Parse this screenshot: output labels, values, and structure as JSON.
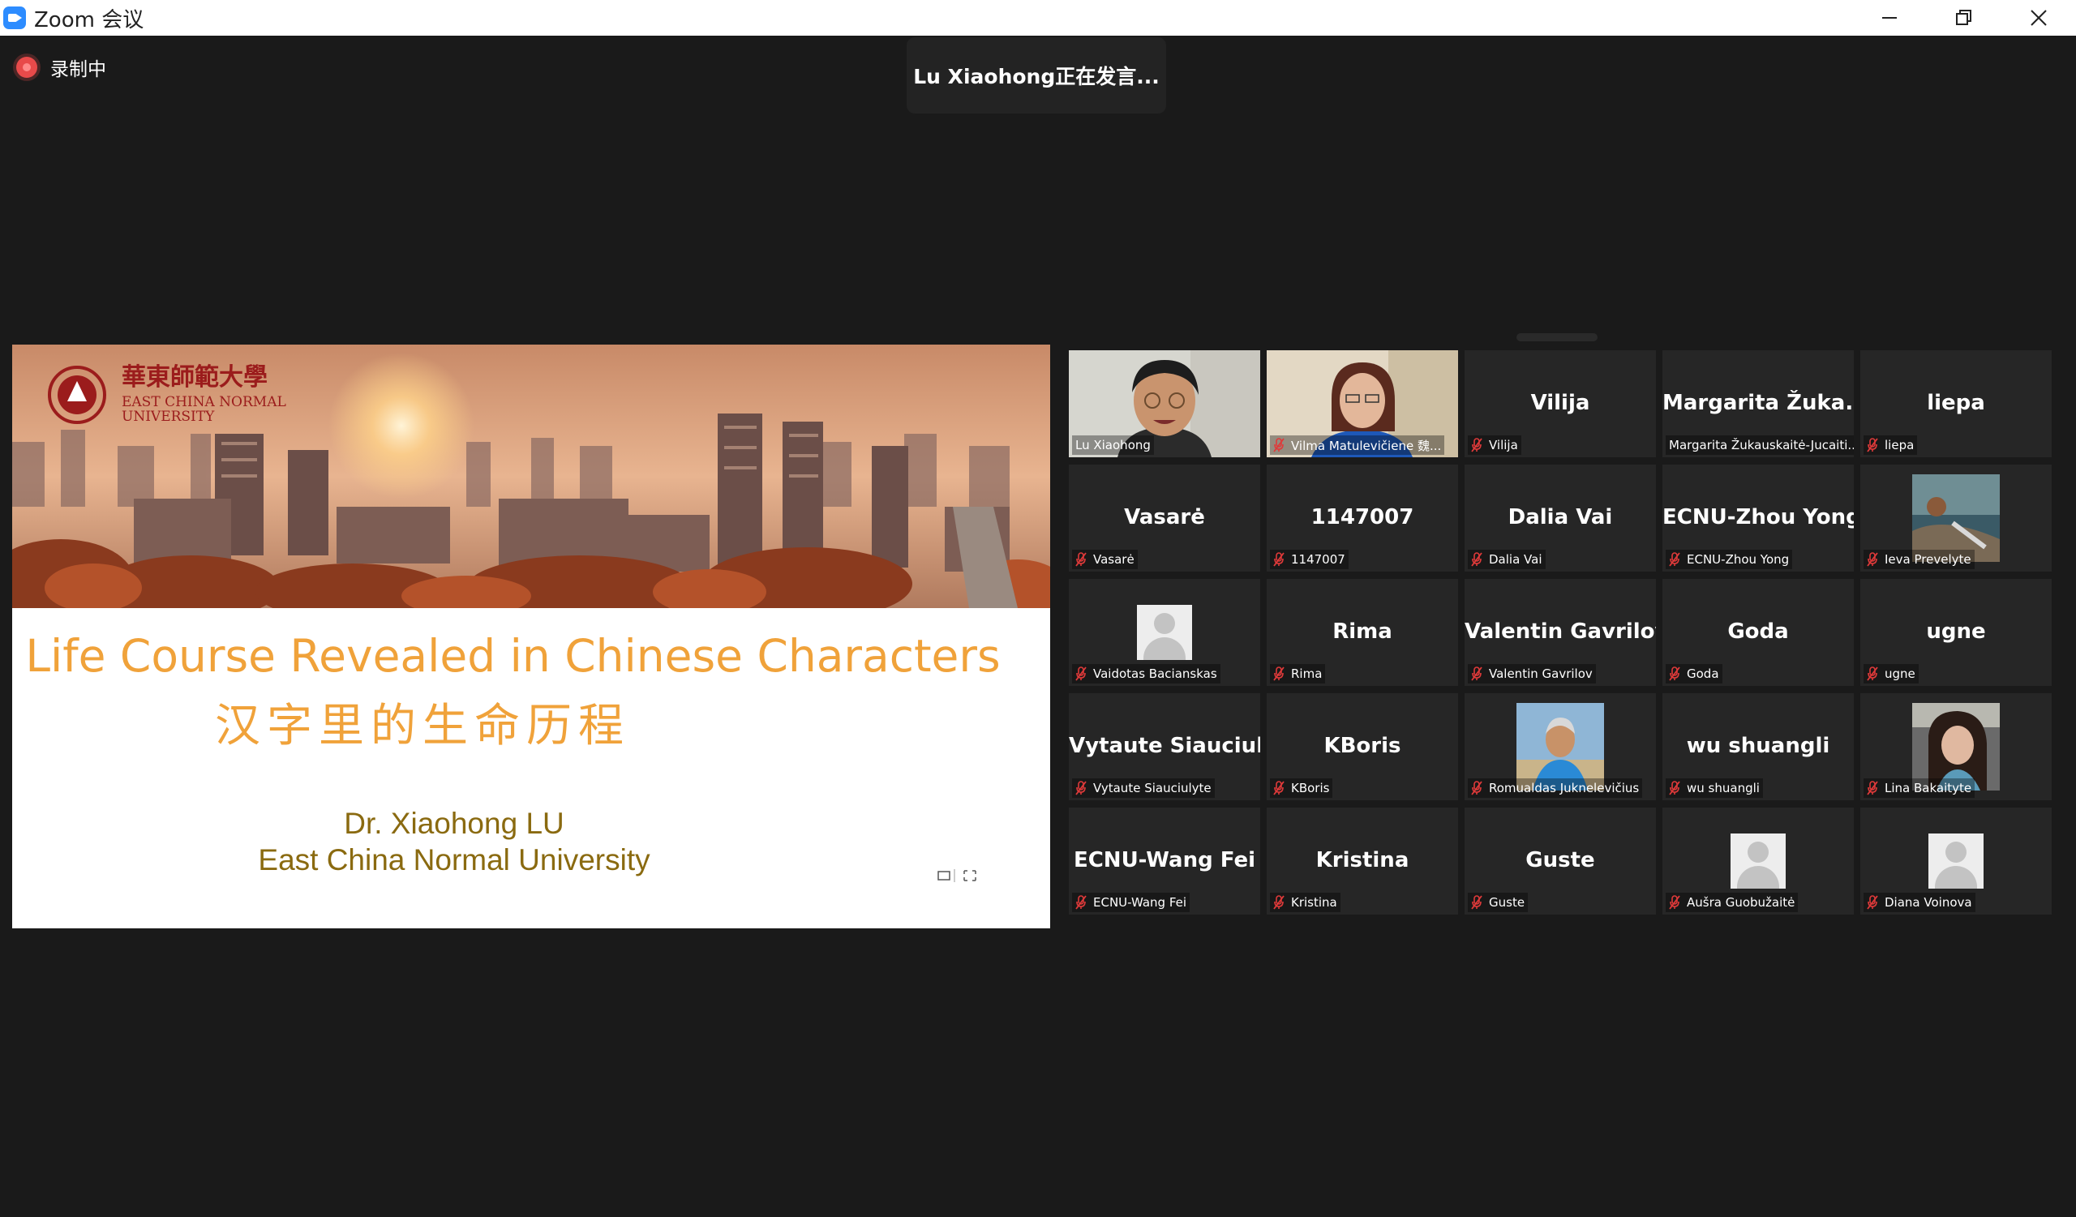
{
  "window": {
    "title": "Zoom 会议"
  },
  "recording": {
    "label": "录制中"
  },
  "speaker_banner": {
    "text": "Lu Xiaohong正在发言..."
  },
  "slide": {
    "title": "Life Course Revealed in Chinese Characters",
    "subtitle": "汉字里的生命历程",
    "author": "Dr. Xiaohong LU",
    "affiliation": "East China Normal University",
    "logo_text": "華東師範大學 EAST CHINA NORMAL UNIVERSITY"
  },
  "participants": [
    {
      "display": "",
      "label": "Lu Xiaohong",
      "type": "video-face",
      "muted": false,
      "active": true
    },
    {
      "display": "",
      "label": "Vilma Matulevičiene 魏...",
      "type": "video-woman",
      "muted": true
    },
    {
      "display": "Vilija",
      "label": "Vilija",
      "type": "name",
      "muted": true
    },
    {
      "display": "Margarita Žuka...",
      "label": "Margarita Žukauskaitė-Jucaiti...",
      "type": "name",
      "muted": false
    },
    {
      "display": "liepa",
      "label": "liepa",
      "type": "name",
      "muted": true
    },
    {
      "display": "Vasarė",
      "label": "Vasarė",
      "type": "name",
      "muted": true
    },
    {
      "display": "1147007",
      "label": "1147007",
      "type": "name",
      "muted": true
    },
    {
      "display": "Dalia Vai",
      "label": "Dalia Vai",
      "type": "name",
      "muted": true
    },
    {
      "display": "ECNU-Zhou Yong",
      "label": "ECNU-Zhou Yong",
      "type": "name",
      "muted": true
    },
    {
      "display": "",
      "label": "Ieva Prevelyte",
      "type": "photo-landscape",
      "muted": true
    },
    {
      "display": "",
      "label": "Vaidotas Bacianskas",
      "type": "avatar",
      "muted": true
    },
    {
      "display": "Rima",
      "label": "Rima",
      "type": "name",
      "muted": true
    },
    {
      "display": "Valentin Gavrilov",
      "label": "Valentin Gavrilov",
      "type": "name",
      "muted": true
    },
    {
      "display": "Goda",
      "label": "Goda",
      "type": "name",
      "muted": true
    },
    {
      "display": "ugne",
      "label": "ugne",
      "type": "name",
      "muted": true
    },
    {
      "display": "Vytaute Siauciul...",
      "label": "Vytaute Siauciulyte",
      "type": "name",
      "muted": true
    },
    {
      "display": "KBoris",
      "label": "KBoris",
      "type": "name",
      "muted": true
    },
    {
      "display": "",
      "label": "Romualdas Juknelevičius",
      "type": "photo-man",
      "muted": true
    },
    {
      "display": "wu shuangli",
      "label": "wu shuangli",
      "type": "name",
      "muted": true
    },
    {
      "display": "",
      "label": "Lina Bakaityte",
      "type": "photo-girl",
      "muted": true
    },
    {
      "display": "ECNU-Wang Fei",
      "label": "ECNU-Wang Fei",
      "type": "name",
      "muted": true
    },
    {
      "display": "Kristina",
      "label": "Kristina",
      "type": "name",
      "muted": true
    },
    {
      "display": "Guste",
      "label": "Guste",
      "type": "name",
      "muted": true
    },
    {
      "display": "",
      "label": "Aušra Guobužaitė",
      "type": "avatar",
      "muted": true
    },
    {
      "display": "",
      "label": "Diana Voinova",
      "type": "avatar",
      "muted": true
    }
  ],
  "colors": {
    "active_speaker": "#c6e564",
    "slide_title": "#f0a23a",
    "slide_text": "#8a6a10",
    "mute": "#e03a3a"
  }
}
